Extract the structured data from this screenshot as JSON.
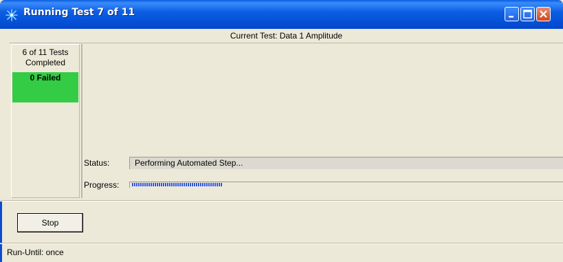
{
  "window": {
    "title": "Running Test 7 of 11",
    "app_icon": "sparkle-icon",
    "title_bar_color": "#0a5fe0",
    "controls": [
      "minimize-icon",
      "maximize-icon",
      "close-icon"
    ]
  },
  "header": {
    "current_test": "Current Test: Data 1 Amplitude"
  },
  "summary": {
    "line1": "6 of 11 Tests",
    "line2": "Completed",
    "failed": "0 Failed",
    "failed_color": "#33cc44"
  },
  "status": {
    "label": "Status:",
    "value": "Performing Automated Step..."
  },
  "progress": {
    "label": "Progress:",
    "fraction": 0.21,
    "color": "#2b50d8"
  },
  "actions": {
    "stop_label": "Stop"
  },
  "footer": {
    "run_until": "Run-Until: once"
  }
}
